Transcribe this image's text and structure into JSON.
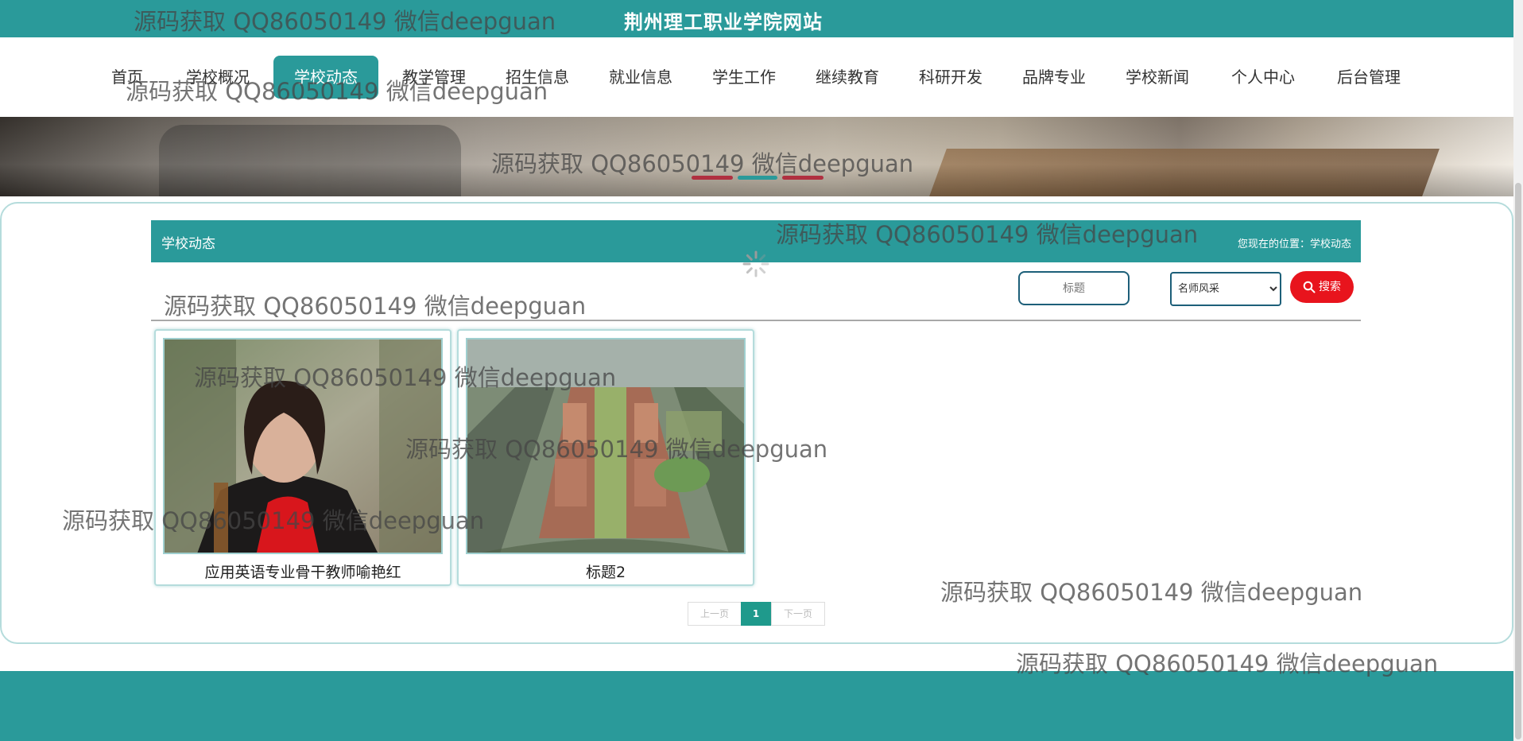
{
  "site": {
    "title": "荆州理工职业学院网站"
  },
  "nav": {
    "items": [
      {
        "label": "首页",
        "active": false
      },
      {
        "label": "学校概况",
        "active": false
      },
      {
        "label": "学校动态",
        "active": true
      },
      {
        "label": "教学管理",
        "active": false
      },
      {
        "label": "招生信息",
        "active": false
      },
      {
        "label": "就业信息",
        "active": false
      },
      {
        "label": "学生工作",
        "active": false
      },
      {
        "label": "继续教育",
        "active": false
      },
      {
        "label": "科研开发",
        "active": false
      },
      {
        "label": "品牌专业",
        "active": false
      },
      {
        "label": "学校新闻",
        "active": false
      },
      {
        "label": "个人中心",
        "active": false
      },
      {
        "label": "后台管理",
        "active": false
      }
    ]
  },
  "section": {
    "title": "学校动态",
    "breadcrumb": "您现在的位置：学校动态"
  },
  "search": {
    "title_placeholder": "标题",
    "type_selected": "名师风采",
    "button_label": "搜索"
  },
  "items": [
    {
      "title": "应用英语专业骨干教师喻艳红",
      "image": "teacher-portrait"
    },
    {
      "title": "标题2",
      "image": "campus-aerial-view"
    }
  ],
  "pagination": {
    "prev": "上一页",
    "current": "1",
    "next": "下一页"
  },
  "watermark": {
    "text": "源码获取 QQ86050149 微信deepguan"
  },
  "colors": {
    "primary": "#2a9a9a",
    "search_button": "#e8141d",
    "input_border": "#1d5f79"
  }
}
